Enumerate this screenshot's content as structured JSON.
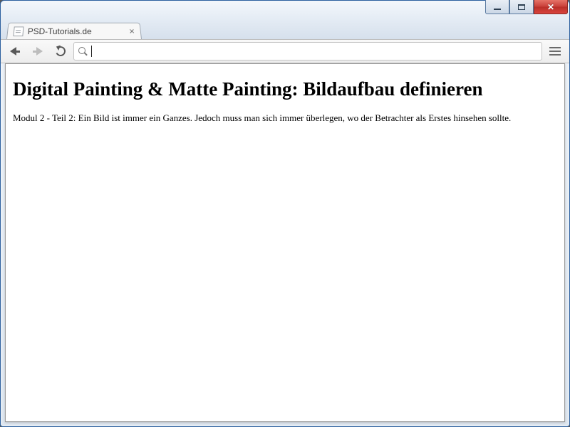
{
  "window": {
    "title": "PSD-Tutorials.de"
  },
  "tab": {
    "title": "PSD-Tutorials.de"
  },
  "omnibox": {
    "value": "",
    "placeholder": ""
  },
  "page": {
    "heading": "Digital Painting & Matte Painting: Bildaufbau definieren",
    "body": "Modul 2 - Teil 2: Ein Bild ist immer ein Ganzes. Jedoch muss man sich immer überlegen, wo der Betrachter als Erstes hinsehen sollte."
  }
}
